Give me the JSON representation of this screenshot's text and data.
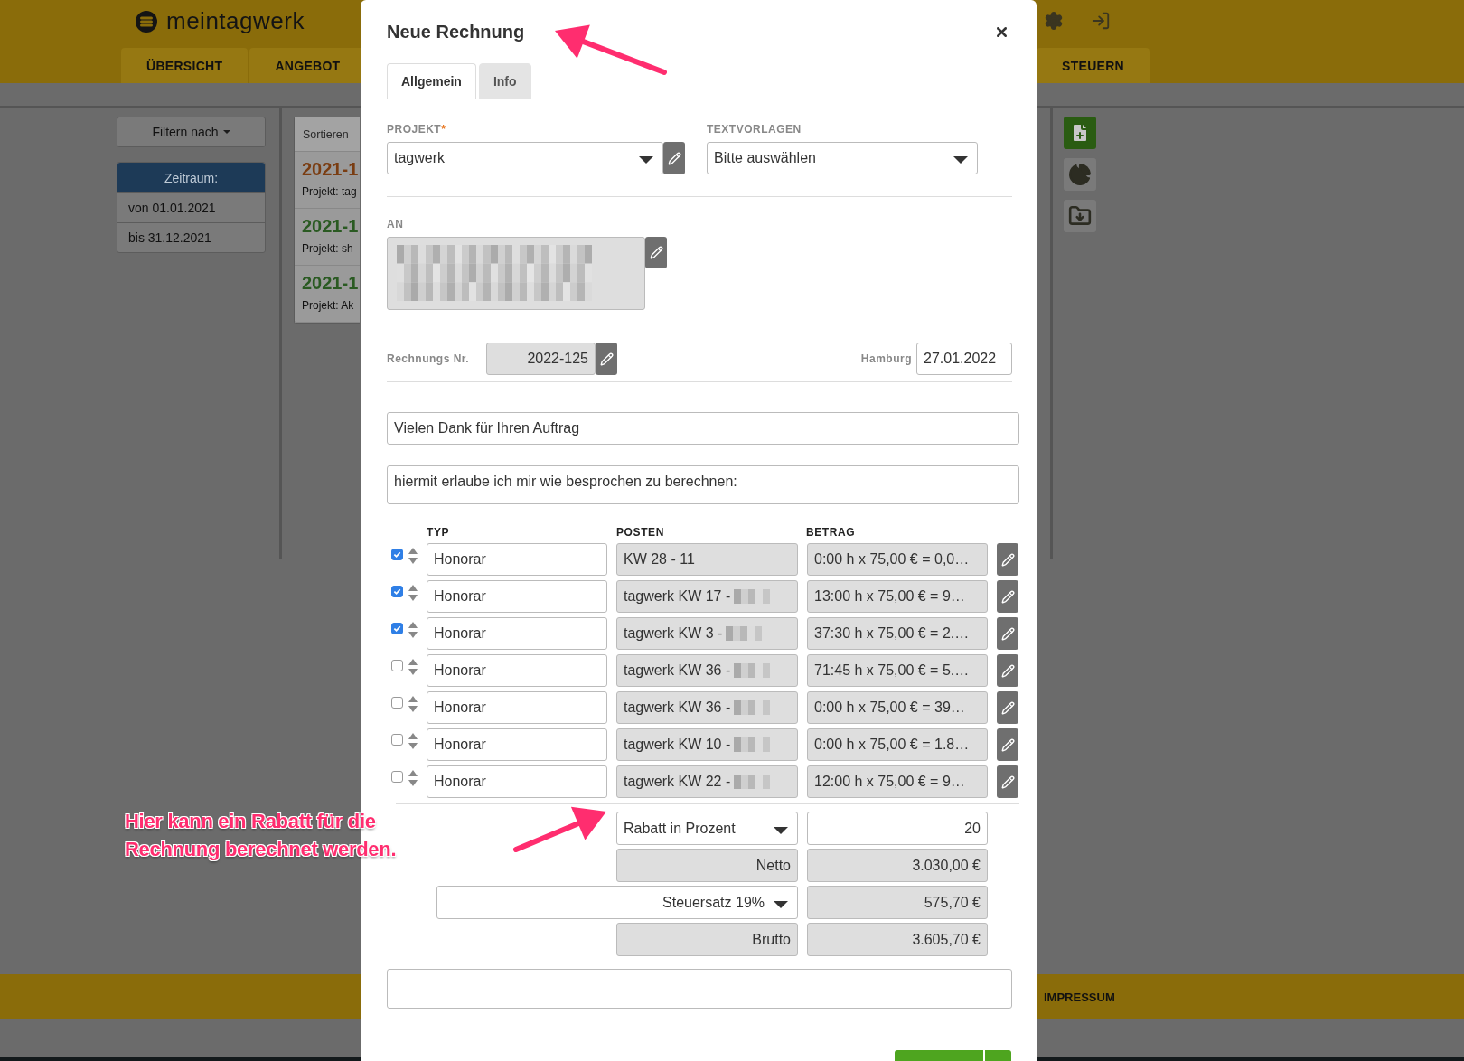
{
  "header": {
    "logo": "meintagwerk",
    "nav_left": [
      {
        "label": "ÜBERSICHT"
      },
      {
        "label": "ANGEBOT"
      }
    ],
    "nav_right": [
      {
        "label": "STEUERN"
      }
    ]
  },
  "sidebar": {
    "filter_button": "Filtern nach",
    "period": {
      "title": "Zeitraum:",
      "items": [
        "von 01.01.2021",
        "bis 31.12.2021"
      ]
    }
  },
  "invoice_list": {
    "sort_label": "Sortieren",
    "items": [
      {
        "number": "2021-1",
        "project": "Projekt: tag",
        "color": "#7a3d12"
      },
      {
        "number": "2021-1",
        "project": "Projekt: sh",
        "color": "#2a5a22"
      },
      {
        "number": "2021-1",
        "project": "Projekt: Ak",
        "color": "#2a5a22"
      }
    ]
  },
  "modal": {
    "title": "Neue Rechnung",
    "tabs": [
      {
        "label": "Allgemein",
        "selected": true
      },
      {
        "label": "Info",
        "selected": false
      }
    ],
    "project": {
      "label": "PROJEKT",
      "required_mark": "*",
      "value": "tagwerk"
    },
    "templates": {
      "label": "TEXTVORLAGEN",
      "value": "Bitte auswählen"
    },
    "recipient": {
      "label": "AN"
    },
    "invoice_number": {
      "label": "Rechnungs Nr.",
      "value": "2022-125"
    },
    "place_date": {
      "label": "Hamburg",
      "value": "27.01.2022"
    },
    "intro_text": "Vielen Dank für Ihren Auftrag",
    "body_text": "hiermit erlaube ich mir wie besprochen zu berechnen:",
    "items": {
      "columns": [
        "TYP",
        "POSTEN",
        "BETRAG"
      ],
      "rows": [
        {
          "checked": true,
          "type": "Honorar",
          "item": "KW 28 - 11",
          "redacted": false,
          "amount": "0:00 h x 75,00 € = 0,0…"
        },
        {
          "checked": true,
          "type": "Honorar",
          "item": "tagwerk KW 17 -",
          "redacted": true,
          "amount": "13:00 h x 75,00 € = 9…"
        },
        {
          "checked": true,
          "type": "Honorar",
          "item": "tagwerk KW 3 -",
          "redacted": true,
          "amount": "37:30 h x 75,00 € = 2.…"
        },
        {
          "checked": false,
          "type": "Honorar",
          "item": "tagwerk KW 36 -",
          "redacted": true,
          "amount": "71:45 h x 75,00 € = 5.…"
        },
        {
          "checked": false,
          "type": "Honorar",
          "item": "tagwerk KW 36 -",
          "redacted": true,
          "amount": "0:00 h x 75,00 € = 39…"
        },
        {
          "checked": false,
          "type": "Honorar",
          "item": "tagwerk KW 10 -",
          "redacted": true,
          "amount": "0:00 h x 75,00 € = 1.8…"
        },
        {
          "checked": false,
          "type": "Honorar",
          "item": "tagwerk KW 22 -",
          "redacted": true,
          "amount": "12:00 h x 75,00 € = 9…"
        }
      ]
    },
    "totals": {
      "discount_type": "Rabatt in Prozent",
      "discount_value": "20",
      "net_label": "Netto",
      "net": "3.030,00 €",
      "tax_rate": "Steuersatz 19%",
      "tax": "575,70 €",
      "gross_label": "Brutto",
      "gross": "3.605,70 €"
    }
  },
  "footer": {
    "link": "IMPRESSUM"
  },
  "annotations": [
    {
      "text": "Hier kann ein Rabatt für die Rechnung berechnet werden."
    }
  ]
}
